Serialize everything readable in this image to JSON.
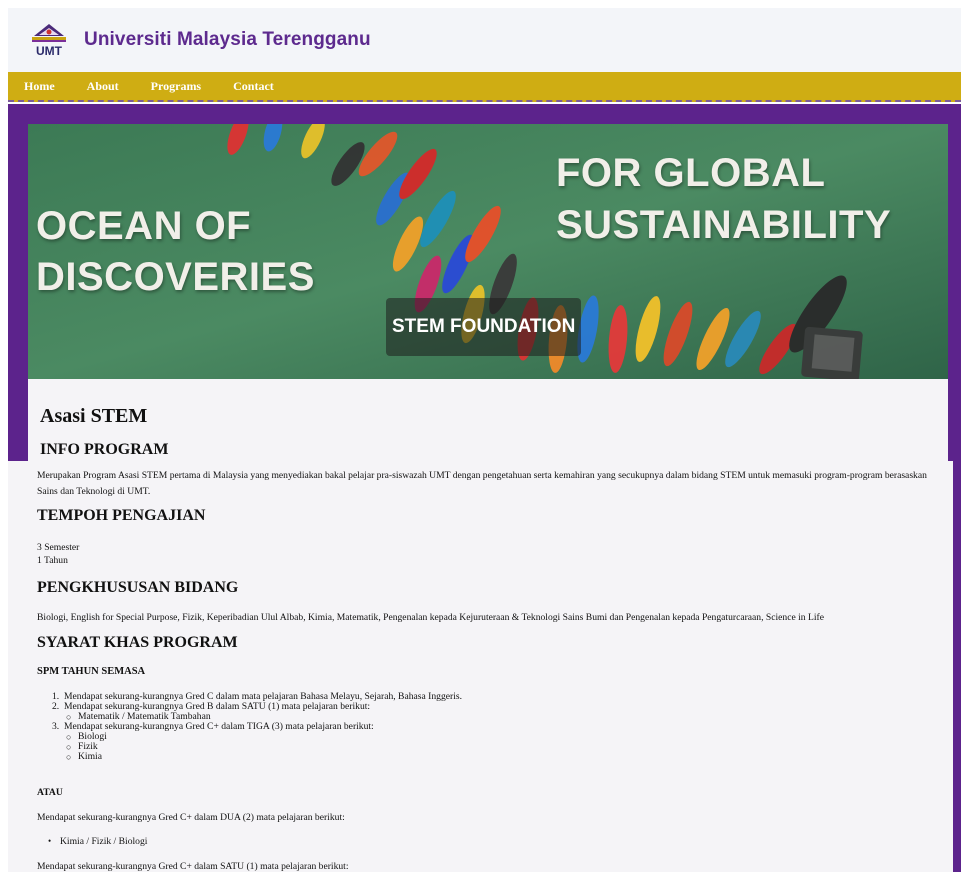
{
  "header": {
    "logo_text": "UMT",
    "title": "Universiti Malaysia Terengganu"
  },
  "nav": {
    "items": [
      "Home",
      "About",
      "Programs",
      "Contact"
    ]
  },
  "hero": {
    "line1": "OCEAN OF",
    "line2": "DISCOVERIES",
    "line3": "FOR GLOBAL",
    "line4": "SUSTAINABILITY",
    "badge": "STEM FOUNDATION"
  },
  "content": {
    "title": "Asasi STEM",
    "info_heading": "INFO PROGRAM",
    "info_text": "Merupakan Program Asasi STEM pertama di Malaysia yang menyediakan bakal pelajar pra-siswazah UMT dengan pengetahuan serta kemahiran yang secukupnya dalam bidang STEM untuk memasuki program-program berasaskan Sains dan Teknologi di UMT.",
    "tempoh_heading": "TEMPOH PENGAJIAN",
    "tempoh_line1": "3 Semester",
    "tempoh_line2": "1 Tahun",
    "bidang_heading": "PENGKHUSUSAN BIDANG",
    "bidang_text": "Biologi, English for Special Purpose, Fizik, Keperibadian Ulul Albab, Kimia, Matematik, Pengenalan kepada Kejuruteraan & Teknologi Sains Bumi dan Pengenalan kepada Pengaturcaraan, Science in Life",
    "syarat_heading": "SYARAT KHAS PROGRAM",
    "spm_heading": "SPM TAHUN SEMASA",
    "req1": "Mendapat sekurang-kurangnya Gred C dalam mata pelajaran Bahasa Melayu, Sejarah, Bahasa Inggeris.",
    "req2": "Mendapat sekurang-kurangnya Gred B dalam SATU (1) mata pelajaran berikut:",
    "req2_sub1": "Matematik / Matematik Tambahan",
    "req3": "Mendapat sekurang-kurangnya Gred C+ dalam TIGA (3) mata pelajaran berikut:",
    "req3_sub1": "Biologi",
    "req3_sub2": "Fizik",
    "req3_sub3": "Kimia",
    "atau": "ATAU",
    "alt1": "Mendapat sekurang-kurangnya Gred C+ dalam DUA (2) mata pelajaran berikut:",
    "alt1_item": "Kimia / Fizik / Biologi",
    "alt2": "Mendapat sekurang-kurangnya Gred C+ dalam SATU (1) mata pelajaran berikut:"
  },
  "colors": {
    "purple": "#5c238c",
    "gold": "#cfad13",
    "title_purple": "#5d2a8e"
  }
}
